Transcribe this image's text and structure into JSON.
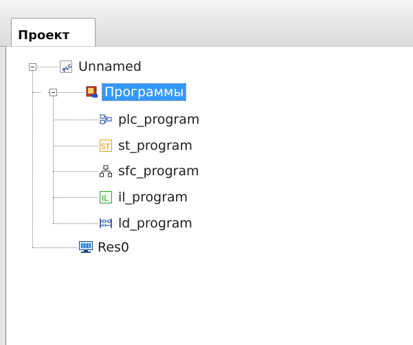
{
  "tabs": [
    {
      "label": "Проект",
      "active": true
    }
  ],
  "tree": {
    "root": {
      "label": "Unnamed",
      "icon": "plc-icon",
      "expanded": true
    },
    "programs": {
      "label": "Программы",
      "icon": "programs-folder-icon",
      "expanded": true,
      "selected": true
    },
    "children": [
      {
        "label": "plc_program",
        "icon": "fbd-program-icon"
      },
      {
        "label": "st_program",
        "icon": "st-program-icon",
        "badge": "ST"
      },
      {
        "label": "sfc_program",
        "icon": "sfc-program-icon"
      },
      {
        "label": "il_program",
        "icon": "il-program-icon",
        "badge": "IL"
      },
      {
        "label": "ld_program",
        "icon": "ld-program-icon"
      }
    ],
    "resource": {
      "label": "Res0",
      "icon": "resource-icon"
    }
  },
  "colors": {
    "selection": "#3399ff",
    "st_badge": "#e0a030",
    "il_badge": "#2e9e2e"
  }
}
